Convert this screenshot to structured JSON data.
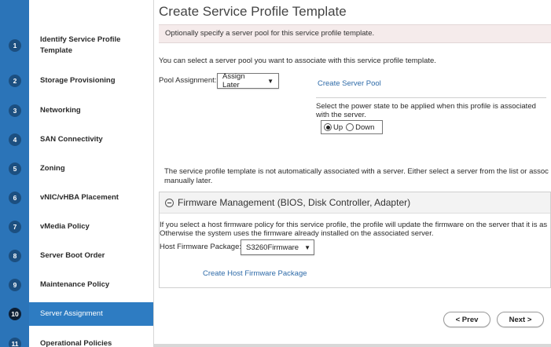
{
  "wizard": {
    "steps": [
      {
        "num": "1",
        "label": "Identify Service Profile Template"
      },
      {
        "num": "2",
        "label": "Storage Provisioning"
      },
      {
        "num": "3",
        "label": "Networking"
      },
      {
        "num": "4",
        "label": "SAN Connectivity"
      },
      {
        "num": "5",
        "label": "Zoning"
      },
      {
        "num": "6",
        "label": "vNIC/vHBA Placement"
      },
      {
        "num": "7",
        "label": "vMedia Policy"
      },
      {
        "num": "8",
        "label": "Server Boot Order"
      },
      {
        "num": "9",
        "label": "Maintenance Policy"
      },
      {
        "num": "10",
        "label": "Server Assignment"
      },
      {
        "num": "11",
        "label": "Operational Policies"
      }
    ],
    "active_step": "10"
  },
  "page": {
    "title": "Create Service Profile Template",
    "info": "Optionally specify a server pool for this service profile template.",
    "pool_intro": "You can select a server pool you want to associate with this service profile template.",
    "pool_label": "Pool Assignment:",
    "pool_value": "Assign Later",
    "create_pool_link": "Create Server Pool",
    "power_text_1": "Select the power state to be applied when this profile is associated",
    "power_text_2": "with the server.",
    "power_up": "Up",
    "power_down": "Down",
    "power_selected": "Up",
    "assoc_text_1": "The service profile template is not automatically associated with a server. Either select a server from the list or assoc",
    "assoc_text_2": "manually later."
  },
  "firmware": {
    "title": "Firmware Management (BIOS, Disk Controller, Adapter)",
    "text_1": "If you select a host firmware policy for this service profile, the profile will update the firmware on the server that it is as",
    "text_2": "Otherwise the system uses the firmware already installed on the associated server.",
    "package_label": "Host Firmware Package:",
    "package_value": "S3260Firmware",
    "create_link": "Create Host Firmware Package"
  },
  "nav": {
    "prev": "< Prev",
    "next": "Next >"
  },
  "colors": {
    "rail_blue": "#2b74b8",
    "active_step_bg": "#2e7cc2",
    "step_circle": "#1c4f80",
    "info_bar": "#f5ebeb",
    "link": "#2d6aa8"
  }
}
